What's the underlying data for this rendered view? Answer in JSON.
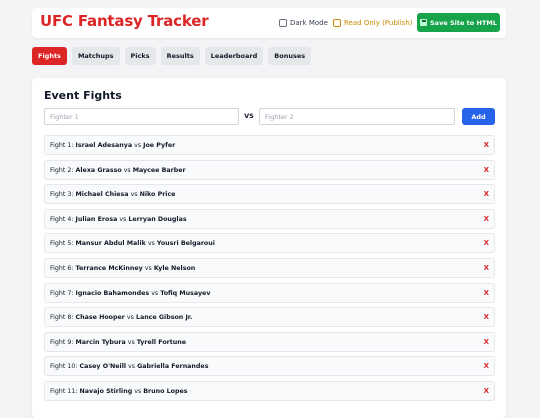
{
  "header": {
    "title": "UFC Fantasy Tracker",
    "dark_mode_label": "Dark Mode",
    "read_only_label": "Read Only (Publish)",
    "save_label": "Save Site to HTML"
  },
  "tabs": [
    {
      "label": "Fights",
      "active": true
    },
    {
      "label": "Matchups",
      "active": false
    },
    {
      "label": "Picks",
      "active": false
    },
    {
      "label": "Results",
      "active": false
    },
    {
      "label": "Leaderboard",
      "active": false
    },
    {
      "label": "Bonuses",
      "active": false
    }
  ],
  "event": {
    "title": "Event Fights",
    "fighter1_placeholder": "Fighter 1",
    "fighter2_placeholder": "Fighter 2",
    "vs_label": "VS",
    "add_label": "Add"
  },
  "fights": [
    {
      "prefix": "Fight 1:",
      "fighter1": "Israel Adesanya",
      "vs": "vs",
      "fighter2": "Joe Pyfer",
      "remove": "X"
    },
    {
      "prefix": "Fight 2:",
      "fighter1": "Alexa Grasso",
      "vs": "vs",
      "fighter2": "Maycee Barber",
      "remove": "X"
    },
    {
      "prefix": "Fight 3:",
      "fighter1": "Michael Chiesa",
      "vs": "vs",
      "fighter2": "Niko Price",
      "remove": "X"
    },
    {
      "prefix": "Fight 4:",
      "fighter1": "Julian Erosa",
      "vs": "vs",
      "fighter2": "Lerryan Douglas",
      "remove": "X"
    },
    {
      "prefix": "Fight 5:",
      "fighter1": "Mansur Abdul Malik",
      "vs": "vs",
      "fighter2": "Yousri Belgaroui",
      "remove": "X"
    },
    {
      "prefix": "Fight 6:",
      "fighter1": "Terrance McKinney",
      "vs": "vs",
      "fighter2": "Kyle Nelson",
      "remove": "X"
    },
    {
      "prefix": "Fight 7:",
      "fighter1": "Ignacio Bahamondes",
      "vs": "vs",
      "fighter2": "Tofiq Musayev",
      "remove": "X"
    },
    {
      "prefix": "Fight 8:",
      "fighter1": "Chase Hooper",
      "vs": "vs",
      "fighter2": "Lance Gibson Jr.",
      "remove": "X"
    },
    {
      "prefix": "Fight 9:",
      "fighter1": "Marcin Tybura",
      "vs": "vs",
      "fighter2": "Tyrell Fortune",
      "remove": "X"
    },
    {
      "prefix": "Fight 10:",
      "fighter1": "Casey O'Neill",
      "vs": "vs",
      "fighter2": "Gabriella Fernandes",
      "remove": "X"
    },
    {
      "prefix": "Fight 11:",
      "fighter1": "Navajo Stirling",
      "vs": "vs",
      "fighter2": "Bruno Lopes",
      "remove": "X"
    }
  ],
  "colors": {
    "brand_red": "#dc2626",
    "save_green": "#16a34a",
    "add_blue": "#2563eb",
    "read_only_gold": "#ca8a04"
  },
  "icons": {
    "save": "save-disk-icon"
  }
}
